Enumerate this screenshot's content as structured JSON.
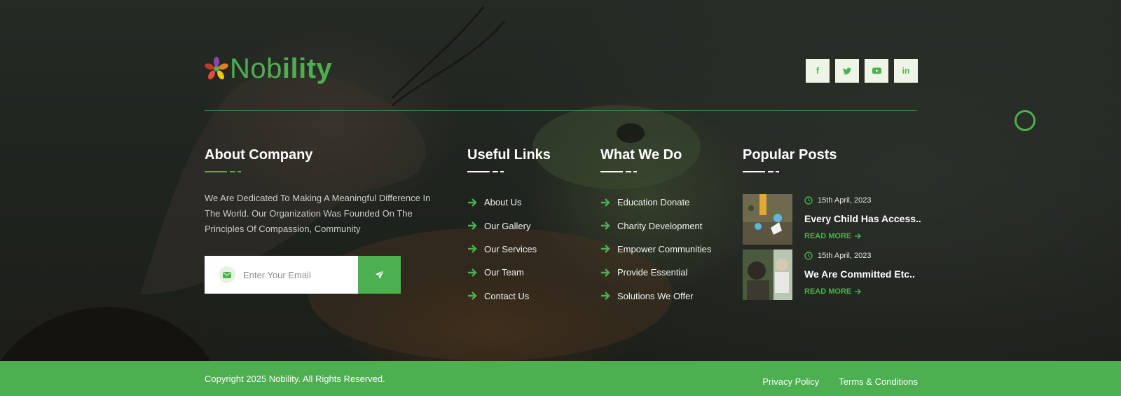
{
  "brand": {
    "name_light": "Nob",
    "name_bold": "ility"
  },
  "social": [
    {
      "icon": "facebook-icon",
      "glyph": "f"
    },
    {
      "icon": "twitter-icon",
      "glyph": ""
    },
    {
      "icon": "youtube-icon",
      "glyph": ""
    },
    {
      "icon": "linkedin-icon",
      "glyph": "in"
    }
  ],
  "about": {
    "title": "About Company",
    "text": "We Are Dedicated To Making A Meaningful Difference In The World. Our Organization Was Founded On The Principles Of Compassion, Community",
    "email_placeholder": "Enter Your Email"
  },
  "useful_links": {
    "title": "Useful Links",
    "items": [
      "About Us",
      "Our Gallery",
      "Our Services",
      "Our Team",
      "Contact Us"
    ]
  },
  "what_we_do": {
    "title": "What We Do",
    "items": [
      "Education Donate",
      "Charity Development",
      "Empower Communities",
      "Provide Essential",
      "Solutions We Offer"
    ]
  },
  "popular_posts": {
    "title": "Popular Posts",
    "items": [
      {
        "date": "15th April, 2023",
        "title": "Every Child Has Access..",
        "read_more": "READ MORE"
      },
      {
        "date": "15th April, 2023",
        "title": "We Are Committed Etc..",
        "read_more": "READ MORE"
      }
    ]
  },
  "footer": {
    "copyright": "Copyright 2025 Nobility. All Rights Reserved.",
    "links": [
      "Privacy Policy",
      "Terms & Conditions"
    ]
  },
  "colors": {
    "accent": "#4caf50",
    "bar": "#4caf50",
    "background": "#1e221d"
  }
}
